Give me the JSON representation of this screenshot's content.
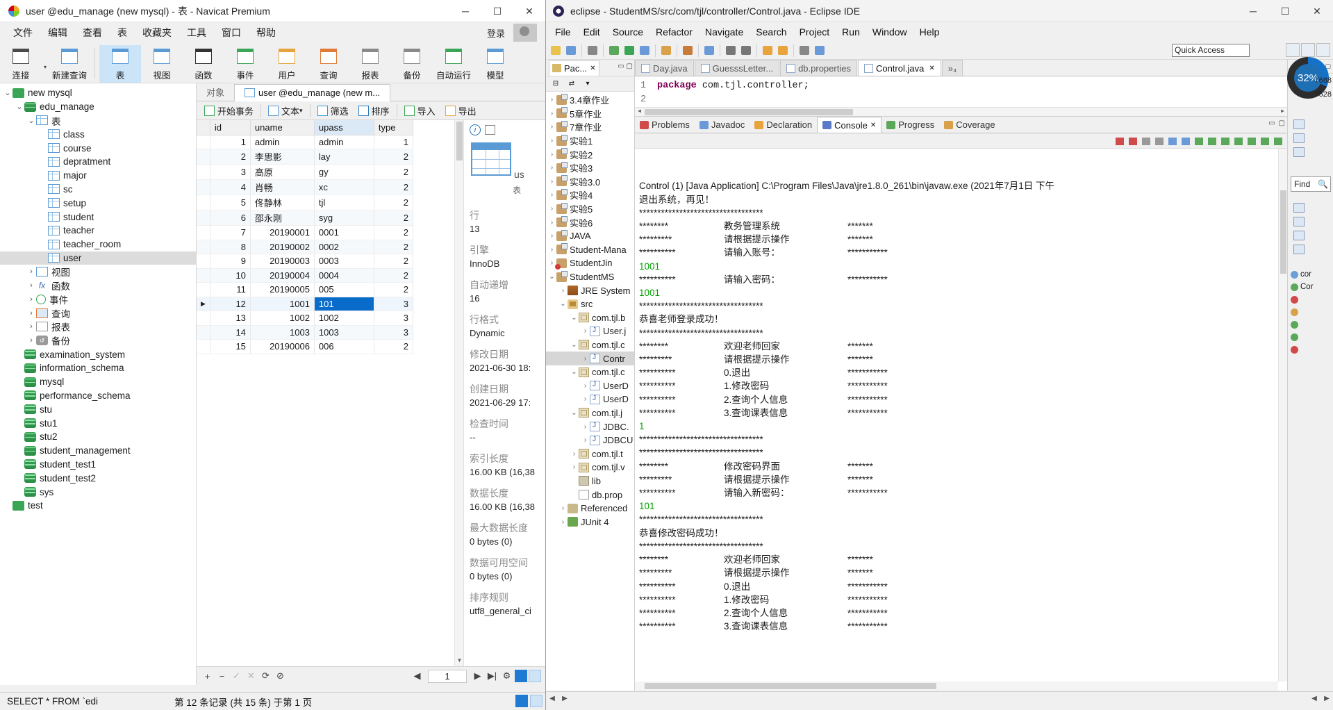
{
  "navicat": {
    "title": "user @edu_manage (new mysql) - 表 - Navicat Premium",
    "window_buttons": {
      "minimize": "─",
      "maximize": "☐",
      "close": "✕"
    },
    "menus": [
      "文件",
      "编辑",
      "查看",
      "表",
      "收藏夹",
      "工具",
      "窗口",
      "帮助"
    ],
    "login_label": "登录",
    "toolbar": [
      {
        "label": "连接",
        "icon": "connection-icon"
      },
      {
        "label": "新建查询",
        "icon": "new-query-icon"
      },
      {
        "label": "表",
        "icon": "table-icon",
        "active": true
      },
      {
        "label": "视图",
        "icon": "view-icon"
      },
      {
        "label": "函数",
        "icon": "function-icon"
      },
      {
        "label": "事件",
        "icon": "event-icon"
      },
      {
        "label": "用户",
        "icon": "user-icon"
      },
      {
        "label": "查询",
        "icon": "query-icon"
      },
      {
        "label": "报表",
        "icon": "report-icon"
      },
      {
        "label": "备份",
        "icon": "backup-icon"
      },
      {
        "label": "自动运行",
        "icon": "automation-icon"
      },
      {
        "label": "模型",
        "icon": "model-icon"
      }
    ],
    "tree": [
      {
        "label": "new mysql",
        "indent": 0,
        "twisty": "⌄",
        "icon": "connection-icon"
      },
      {
        "label": "edu_manage",
        "indent": 1,
        "twisty": "⌄",
        "icon": "database-icon"
      },
      {
        "label": "表",
        "indent": 2,
        "twisty": "⌄",
        "icon": "table-folder-icon"
      },
      {
        "label": "class",
        "indent": 3,
        "twisty": "",
        "icon": "table-icon"
      },
      {
        "label": "course",
        "indent": 3,
        "twisty": "",
        "icon": "table-icon"
      },
      {
        "label": "depratment",
        "indent": 3,
        "twisty": "",
        "icon": "table-icon"
      },
      {
        "label": "major",
        "indent": 3,
        "twisty": "",
        "icon": "table-icon"
      },
      {
        "label": "sc",
        "indent": 3,
        "twisty": "",
        "icon": "table-icon"
      },
      {
        "label": "setup",
        "indent": 3,
        "twisty": "",
        "icon": "table-icon"
      },
      {
        "label": "student",
        "indent": 3,
        "twisty": "",
        "icon": "table-icon"
      },
      {
        "label": "teacher",
        "indent": 3,
        "twisty": "",
        "icon": "table-icon"
      },
      {
        "label": "teacher_room",
        "indent": 3,
        "twisty": "",
        "icon": "table-icon"
      },
      {
        "label": "user",
        "indent": 3,
        "twisty": "",
        "icon": "table-icon",
        "selected": true
      },
      {
        "label": "视图",
        "indent": 2,
        "twisty": "›",
        "icon": "view-icon"
      },
      {
        "label": "函数",
        "indent": 2,
        "twisty": "›",
        "icon": "function-icon"
      },
      {
        "label": "事件",
        "indent": 2,
        "twisty": "›",
        "icon": "event-icon"
      },
      {
        "label": "查询",
        "indent": 2,
        "twisty": "›",
        "icon": "query-icon"
      },
      {
        "label": "报表",
        "indent": 2,
        "twisty": "›",
        "icon": "report-icon"
      },
      {
        "label": "备份",
        "indent": 2,
        "twisty": "›",
        "icon": "backup-icon"
      },
      {
        "label": "examination_system",
        "indent": 1,
        "twisty": "",
        "icon": "database-icon"
      },
      {
        "label": "information_schema",
        "indent": 1,
        "twisty": "",
        "icon": "database-icon"
      },
      {
        "label": "mysql",
        "indent": 1,
        "twisty": "",
        "icon": "database-icon"
      },
      {
        "label": "performance_schema",
        "indent": 1,
        "twisty": "",
        "icon": "database-icon"
      },
      {
        "label": "stu",
        "indent": 1,
        "twisty": "",
        "icon": "database-icon"
      },
      {
        "label": "stu1",
        "indent": 1,
        "twisty": "",
        "icon": "database-icon"
      },
      {
        "label": "stu2",
        "indent": 1,
        "twisty": "",
        "icon": "database-icon"
      },
      {
        "label": "student_management",
        "indent": 1,
        "twisty": "",
        "icon": "database-icon"
      },
      {
        "label": "student_test1",
        "indent": 1,
        "twisty": "",
        "icon": "database-icon"
      },
      {
        "label": "student_test2",
        "indent": 1,
        "twisty": "",
        "icon": "database-icon"
      },
      {
        "label": "sys",
        "indent": 1,
        "twisty": "",
        "icon": "database-icon"
      },
      {
        "label": "test",
        "indent": 0,
        "twisty": "",
        "icon": "connection-icon"
      }
    ],
    "tabs": [
      {
        "label": "对象",
        "active": false
      },
      {
        "label": "user @edu_manage (new m...",
        "active": true
      }
    ],
    "grid_toolbar": [
      {
        "label": "开始事务",
        "icon": "transaction-icon"
      },
      {
        "label": "文本",
        "icon": "text-icon",
        "caret": true
      },
      {
        "label": "筛选",
        "icon": "filter-icon"
      },
      {
        "label": "排序",
        "icon": "sort-icon"
      },
      {
        "label": "导入",
        "icon": "import-icon"
      },
      {
        "label": "导出",
        "icon": "export-icon"
      }
    ],
    "grid": {
      "columns": [
        "id",
        "uname",
        "upass",
        "type"
      ],
      "selected_column": "upass",
      "rows": [
        {
          "id": "1",
          "uname": "admin",
          "upass": "admin",
          "type": "1"
        },
        {
          "id": "2",
          "uname": "李思影",
          "upass": "lay",
          "type": "2"
        },
        {
          "id": "3",
          "uname": "高原",
          "upass": "gy",
          "type": "2"
        },
        {
          "id": "4",
          "uname": "肖畅",
          "upass": "xc",
          "type": "2"
        },
        {
          "id": "5",
          "uname": "佟静林",
          "upass": "tjl",
          "type": "2"
        },
        {
          "id": "6",
          "uname": "邵永刚",
          "upass": "syg",
          "type": "2"
        },
        {
          "id": "7",
          "uname": "20190001",
          "upass": "0001",
          "type": "2"
        },
        {
          "id": "8",
          "uname": "20190002",
          "upass": "0002",
          "type": "2"
        },
        {
          "id": "9",
          "uname": "20190003",
          "upass": "0003",
          "type": "2"
        },
        {
          "id": "10",
          "uname": "20190004",
          "upass": "0004",
          "type": "2"
        },
        {
          "id": "11",
          "uname": "20190005",
          "upass": "005",
          "type": "2"
        },
        {
          "id": "12",
          "uname": "1001",
          "upass": "101",
          "type": "3",
          "current": true,
          "cell_selected": "upass"
        },
        {
          "id": "13",
          "uname": "1002",
          "upass": "1002",
          "type": "3"
        },
        {
          "id": "14",
          "uname": "1003",
          "upass": "1003",
          "type": "3"
        },
        {
          "id": "15",
          "uname": "20190006",
          "upass": "006",
          "type": "2"
        }
      ]
    },
    "info_panel": {
      "object_type_label": "us",
      "object_subtype_label": "表",
      "fields": [
        {
          "key": "行",
          "value": "13"
        },
        {
          "key": "引擎",
          "value": "InnoDB"
        },
        {
          "key": "自动递增",
          "value": "16"
        },
        {
          "key": "行格式",
          "value": "Dynamic"
        },
        {
          "key": "修改日期",
          "value": "2021-06-30 18:"
        },
        {
          "key": "创建日期",
          "value": "2021-06-29 17:"
        },
        {
          "key": "检查时间",
          "value": "--"
        },
        {
          "key": "索引长度",
          "value": "16.00 KB (16,38"
        },
        {
          "key": "数据长度",
          "value": "16.00 KB (16,38"
        },
        {
          "key": "最大数据长度",
          "value": "0 bytes (0)"
        },
        {
          "key": "数据可用空间",
          "value": "0 bytes (0)"
        },
        {
          "key": "排序规则",
          "value": "utf8_general_ci"
        }
      ]
    },
    "grid_footer": {
      "buttons": [
        "+",
        "−",
        "✓",
        "✕",
        "⟳",
        "⊘"
      ],
      "page_value": "1",
      "nav": [
        "◀",
        "▶",
        "▶|",
        "⚙"
      ]
    },
    "statusbar": {
      "sql": "SELECT * FROM `edi",
      "records": "第 12 条记录 (共 15 条)     于第 1 页"
    }
  },
  "eclipse": {
    "title": "eclipse - StudentMS/src/com/tjl/controller/Control.java - Eclipse IDE",
    "menus": [
      "File",
      "Edit",
      "Source",
      "Refactor",
      "Navigate",
      "Search",
      "Project",
      "Run",
      "Window",
      "Help"
    ],
    "quick_access": "Quick Access",
    "package_explorer": {
      "tab_label": "Pac...",
      "items": [
        {
          "label": "3.4章作业",
          "indent": 0,
          "twisty": "›",
          "icon": "project-icon"
        },
        {
          "label": "5章作业",
          "indent": 0,
          "twisty": "›",
          "icon": "project-icon"
        },
        {
          "label": "7章作业",
          "indent": 0,
          "twisty": "›",
          "icon": "project-icon"
        },
        {
          "label": "实验1",
          "indent": 0,
          "twisty": "›",
          "icon": "project-icon"
        },
        {
          "label": "实验2",
          "indent": 0,
          "twisty": "›",
          "icon": "project-icon"
        },
        {
          "label": "实验3",
          "indent": 0,
          "twisty": "›",
          "icon": "project-icon"
        },
        {
          "label": "实验3.0",
          "indent": 0,
          "twisty": "›",
          "icon": "project-icon"
        },
        {
          "label": "实验4",
          "indent": 0,
          "twisty": "›",
          "icon": "project-icon"
        },
        {
          "label": "实验5",
          "indent": 0,
          "twisty": "›",
          "icon": "project-icon"
        },
        {
          "label": "实验6",
          "indent": 0,
          "twisty": "›",
          "icon": "project-icon"
        },
        {
          "label": "JAVA",
          "indent": 0,
          "twisty": "›",
          "icon": "project-icon"
        },
        {
          "label": "Student-Mana",
          "indent": 0,
          "twisty": "›",
          "icon": "project-icon"
        },
        {
          "label": "StudentJin",
          "indent": 0,
          "twisty": "›",
          "icon": "project-error-icon"
        },
        {
          "label": "StudentMS",
          "indent": 0,
          "twisty": "⌄",
          "icon": "project-icon"
        },
        {
          "label": "JRE System",
          "indent": 1,
          "twisty": "›",
          "icon": "jre-library-icon"
        },
        {
          "label": "src",
          "indent": 1,
          "twisty": "⌄",
          "icon": "source-folder-icon"
        },
        {
          "label": "com.tjl.b",
          "indent": 2,
          "twisty": "⌄",
          "icon": "package-icon"
        },
        {
          "label": "User.j",
          "indent": 3,
          "twisty": "›",
          "icon": "java-file-icon"
        },
        {
          "label": "com.tjl.c",
          "indent": 2,
          "twisty": "⌄",
          "icon": "package-icon"
        },
        {
          "label": "Contr",
          "indent": 3,
          "twisty": "›",
          "icon": "java-file-icon",
          "selected": true
        },
        {
          "label": "com.tjl.c",
          "indent": 2,
          "twisty": "⌄",
          "icon": "package-icon"
        },
        {
          "label": "UserD",
          "indent": 3,
          "twisty": "›",
          "icon": "java-file-icon"
        },
        {
          "label": "UserD",
          "indent": 3,
          "twisty": "›",
          "icon": "java-file-icon"
        },
        {
          "label": "com.tjl.j",
          "indent": 2,
          "twisty": "⌄",
          "icon": "package-icon"
        },
        {
          "label": "JDBC.",
          "indent": 3,
          "twisty": "›",
          "icon": "java-file-icon"
        },
        {
          "label": "JDBCU",
          "indent": 3,
          "twisty": "›",
          "icon": "java-file-icon"
        },
        {
          "label": "com.tjl.t",
          "indent": 2,
          "twisty": "›",
          "icon": "package-icon"
        },
        {
          "label": "com.tjl.v",
          "indent": 2,
          "twisty": "›",
          "icon": "package-icon"
        },
        {
          "label": "lib",
          "indent": 2,
          "twisty": "",
          "icon": "library-icon"
        },
        {
          "label": "db.prop",
          "indent": 2,
          "twisty": "",
          "icon": "properties-icon"
        },
        {
          "label": "Referenced",
          "indent": 1,
          "twisty": "›",
          "icon": "referenced-libraries-icon"
        },
        {
          "label": "JUnit 4",
          "indent": 1,
          "twisty": "›",
          "icon": "junit-icon"
        }
      ]
    },
    "editor_tabs": [
      {
        "label": "Day.java",
        "active": false
      },
      {
        "label": "GuesssLetter...",
        "active": false
      },
      {
        "label": "db.properties",
        "active": false
      },
      {
        "label": "Control.java",
        "active": true
      }
    ],
    "editor": {
      "line_number": "1",
      "code_keyword": "package",
      "code_rest": " com.tjl.controller;"
    },
    "view_tabs": [
      {
        "label": "Problems",
        "icon": "problems-icon",
        "active": false
      },
      {
        "label": "Javadoc",
        "icon": "javadoc-icon",
        "active": false
      },
      {
        "label": "Declaration",
        "icon": "declaration-icon",
        "active": false
      },
      {
        "label": "Console",
        "icon": "console-icon",
        "active": true
      },
      {
        "label": "Progress",
        "icon": "progress-icon",
        "active": false
      },
      {
        "label": "Coverage",
        "icon": "coverage-icon",
        "active": false
      }
    ],
    "console": {
      "header": "Control (1) [Java Application] C:\\Program Files\\Java\\jre1.8.0_261\\bin\\javaw.exe (2021年7月1日 下午",
      "lines": [
        {
          "text": "退出系统，再见！"
        },
        {
          "text": "**********************************"
        },
        {
          "cols": [
            "********",
            "教务管理系统",
            "*******"
          ]
        },
        {
          "cols": [
            "*********",
            "请根据提示操作",
            "*******"
          ]
        },
        {
          "cols": [
            "**********",
            "请输入账号：",
            "***********"
          ]
        },
        {
          "text": "1001",
          "green": true
        },
        {
          "cols": [
            "**********",
            "请输入密码：",
            "***********"
          ]
        },
        {
          "text": "1001",
          "green": true
        },
        {
          "text": "**********************************"
        },
        {
          "text": "恭喜老师登录成功！"
        },
        {
          "text": "**********************************"
        },
        {
          "cols": [
            "********",
            "欢迎老师回家",
            "*******"
          ]
        },
        {
          "cols": [
            "*********",
            "请根据提示操作",
            "*******"
          ]
        },
        {
          "cols": [
            "**********",
            "0.退出",
            "***********"
          ]
        },
        {
          "cols": [
            "**********",
            "1.修改密码",
            "***********"
          ]
        },
        {
          "cols": [
            "**********",
            "2.查询个人信息",
            "***********"
          ]
        },
        {
          "cols": [
            "**********",
            "3.查询课表信息",
            "***********"
          ]
        },
        {
          "text": "1",
          "green": true
        },
        {
          "text": "**********************************"
        },
        {
          "text": "**********************************"
        },
        {
          "cols": [
            "********",
            "修改密码界面",
            "*******"
          ]
        },
        {
          "cols": [
            "*********",
            "请根据提示操作",
            "*******"
          ]
        },
        {
          "cols": [
            "**********",
            "请输入新密码：",
            "***********"
          ]
        },
        {
          "text": "101",
          "green": true
        },
        {
          "text": "**********************************"
        },
        {
          "text": "恭喜修改密码成功！"
        },
        {
          "text": "**********************************"
        },
        {
          "cols": [
            "********",
            "欢迎老师回家",
            "*******"
          ]
        },
        {
          "cols": [
            "*********",
            "请根据提示操作",
            "*******"
          ]
        },
        {
          "cols": [
            "**********",
            "0.退出",
            "***********"
          ]
        },
        {
          "cols": [
            "**********",
            "1.修改密码",
            "***********"
          ]
        },
        {
          "cols": [
            "**********",
            "2.查询个人信息",
            "***********"
          ]
        },
        {
          "cols": [
            "**********",
            "3.查询课表信息",
            "***********"
          ]
        }
      ]
    },
    "right_panel": {
      "find_label": "Find",
      "memory_percent": "32%",
      "memory_values": [
        "7688",
        "7528"
      ],
      "outline_items": [
        "cor",
        "Cor"
      ]
    }
  }
}
